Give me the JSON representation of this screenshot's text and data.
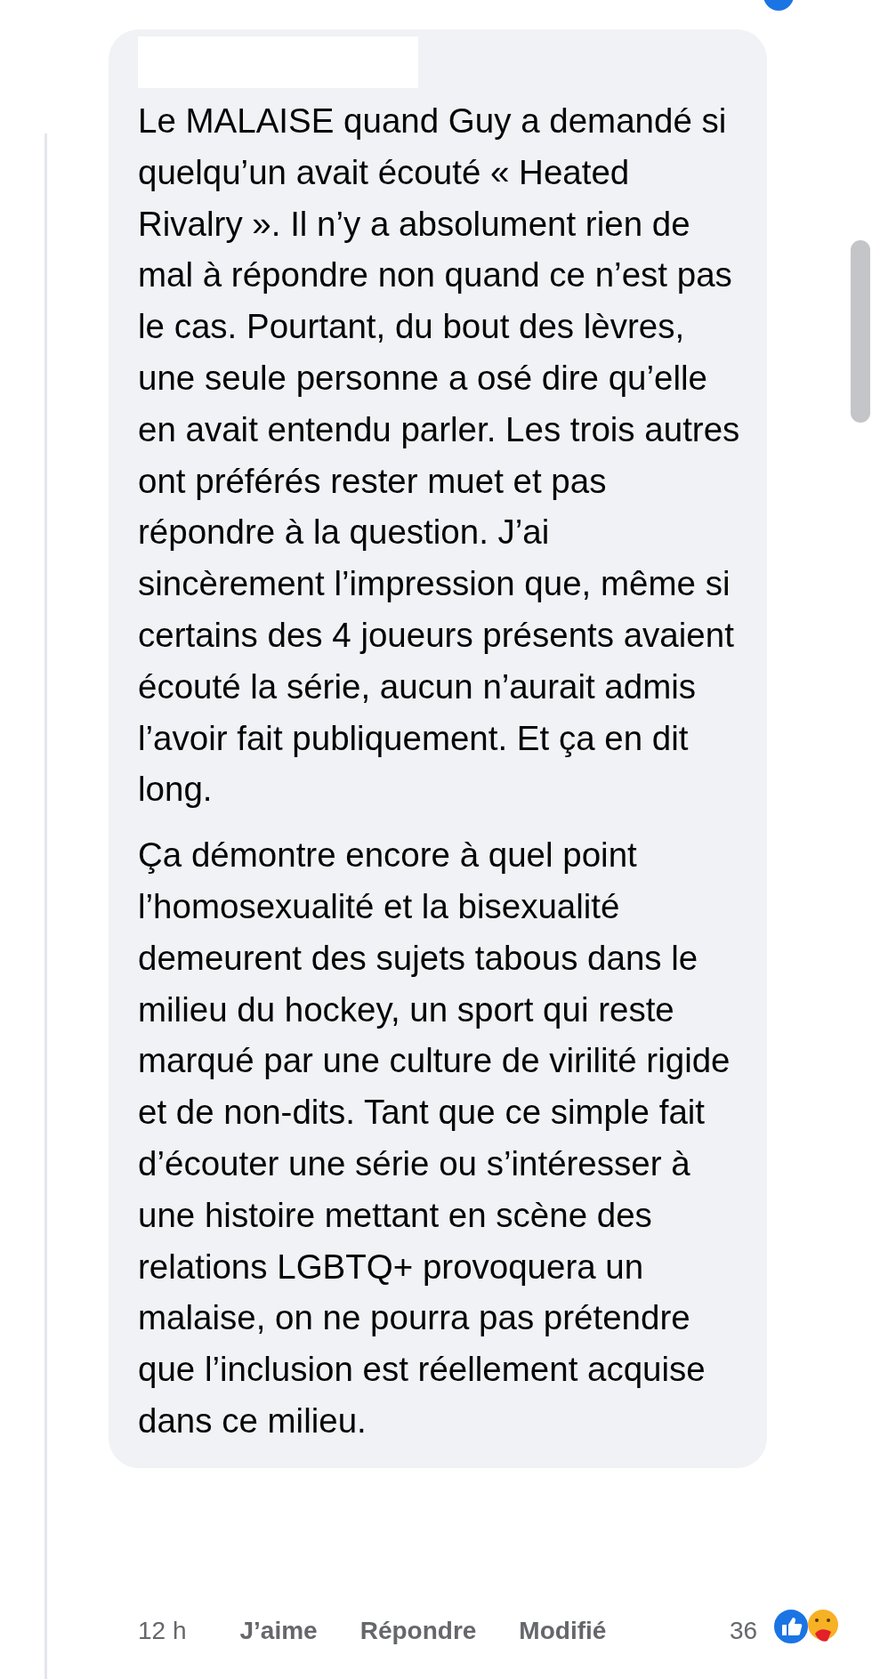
{
  "comment": {
    "paragraphs": [
      "Le MALAISE quand Guy a demandé si quelqu’un avait écouté « Heated Rivalry ». Il n’y a absolument rien de mal à répondre non quand ce n’est pas le cas. Pourtant, du bout des lèvres, une seule personne a osé dire qu’elle en avait entendu parler. Les trois autres ont préférés rester muet et pas répondre à la question. J’ai sincèrement l’impression que, même si certains des 4 joueurs présents avaient écouté la série, aucun n’aurait admis l’avoir fait publiquement. Et ça en dit long.",
      "Ça démontre encore à quel point l’homosexualité et la bisexualité demeurent des sujets tabous dans le milieu du hockey, un sport qui reste marqué par une culture de virilité rigide et de non-dits. Tant que ce simple fait d’écouter une série ou s’intéresser à une histoire mettant en scène des relations LGBTQ+ provoquera un malaise, on ne pourra pas prétendre que l’inclusion est réellement acquise dans ce milieu."
    ]
  },
  "actions": [
    {
      "kind": "time",
      "label": "12 h"
    },
    {
      "kind": "link",
      "label": "J’aime"
    },
    {
      "kind": "link",
      "label": "Répondre"
    },
    {
      "kind": "link",
      "label": "Modifié"
    }
  ],
  "reactions": {
    "count": "36"
  }
}
